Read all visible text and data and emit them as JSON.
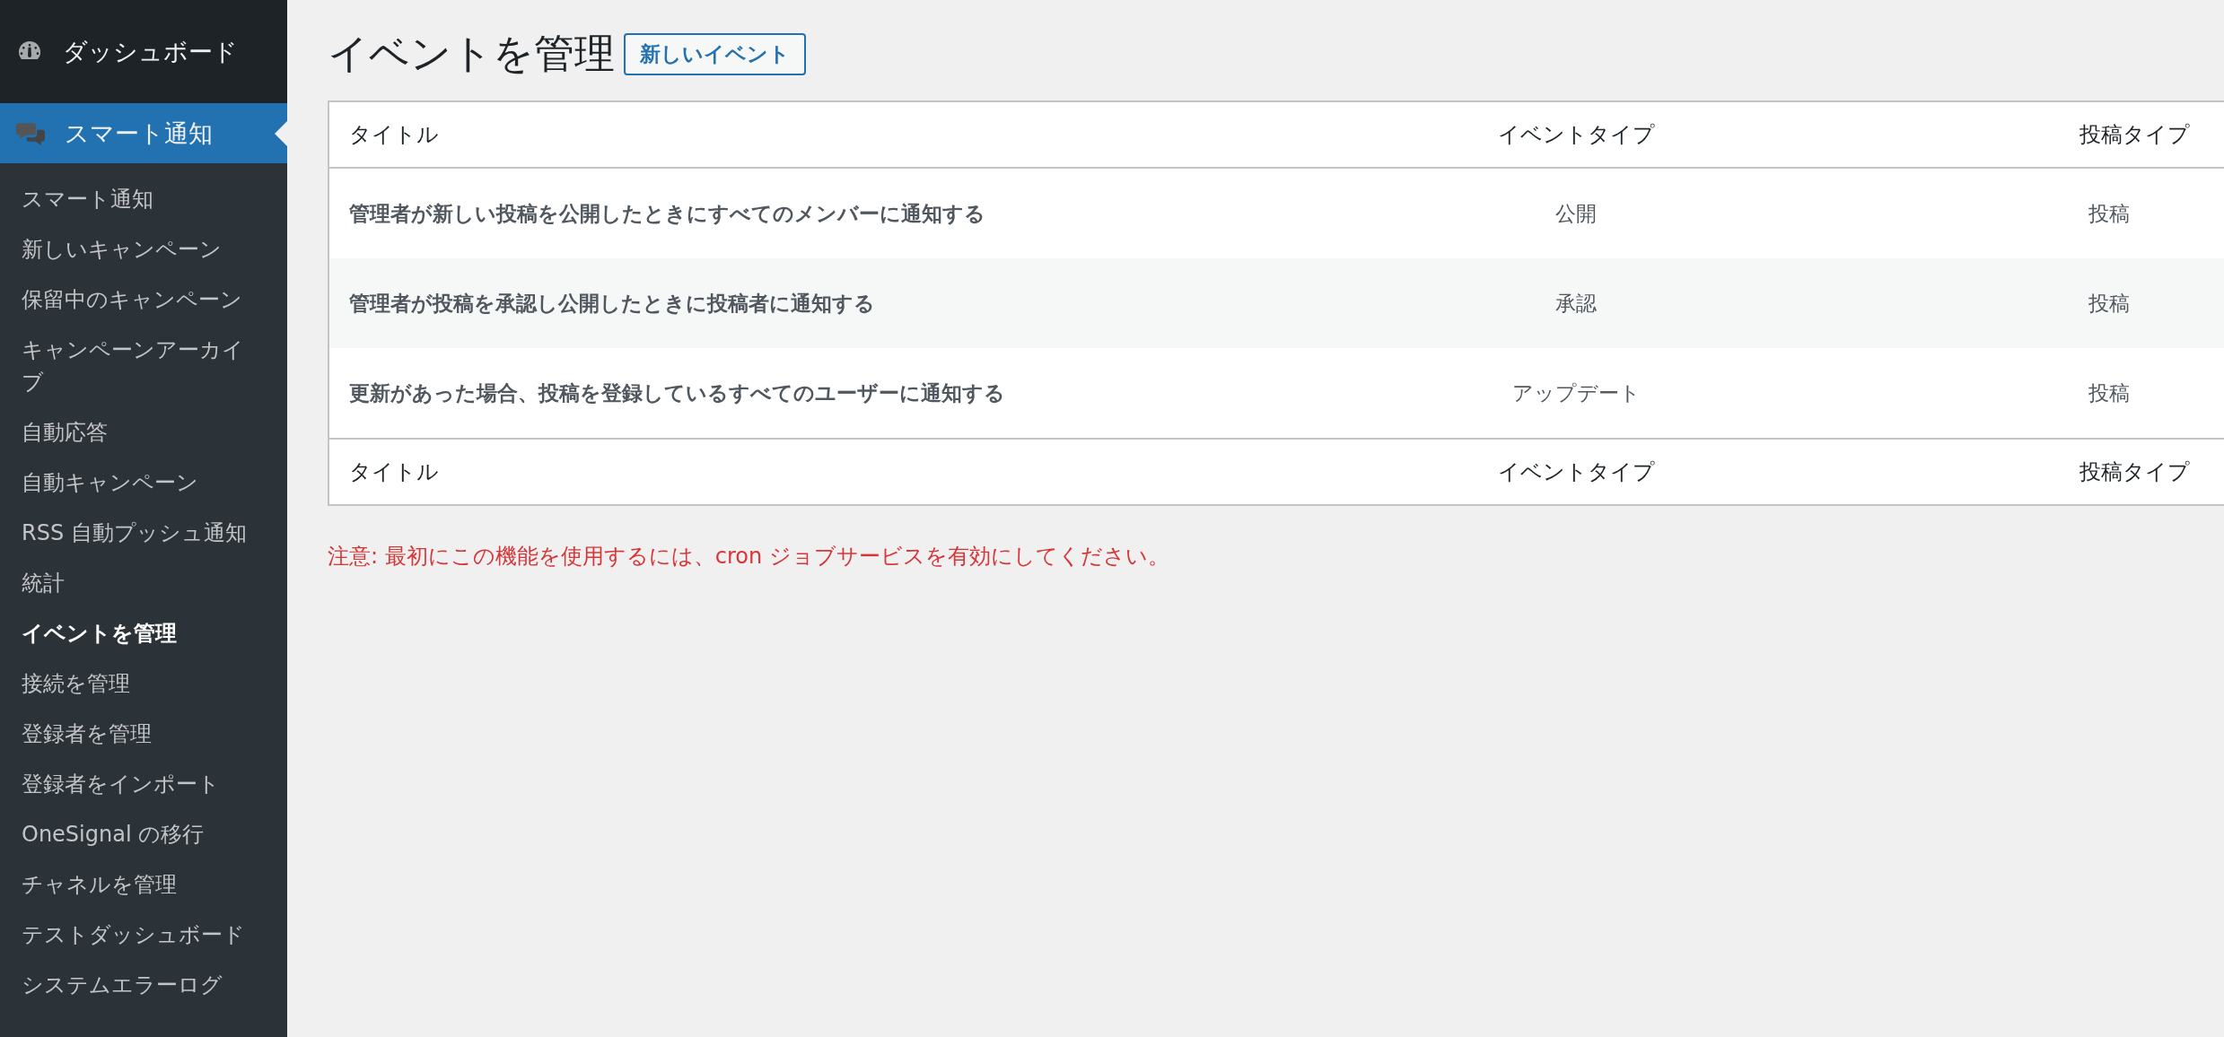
{
  "sidebar": {
    "top_items": [
      {
        "label": "ダッシュボード",
        "selected": false
      },
      {
        "label": "スマート通知",
        "selected": true
      }
    ],
    "submenu": [
      {
        "label": "スマート通知",
        "selected": false
      },
      {
        "label": "新しいキャンペーン",
        "selected": false
      },
      {
        "label": "保留中のキャンペーン",
        "selected": false
      },
      {
        "label": "キャンペーンアーカイブ",
        "selected": false
      },
      {
        "label": "自動応答",
        "selected": false
      },
      {
        "label": "自動キャンペーン",
        "selected": false
      },
      {
        "label": "RSS 自動プッシュ通知",
        "selected": false
      },
      {
        "label": "統計",
        "selected": false
      },
      {
        "label": "イベントを管理",
        "selected": true
      },
      {
        "label": "接続を管理",
        "selected": false
      },
      {
        "label": "登録者を管理",
        "selected": false
      },
      {
        "label": "登録者をインポート",
        "selected": false
      },
      {
        "label": "OneSignal の移行",
        "selected": false
      },
      {
        "label": "チャネルを管理",
        "selected": false
      },
      {
        "label": "テストダッシュボード",
        "selected": false
      },
      {
        "label": "システムエラーログ",
        "selected": false
      }
    ]
  },
  "page": {
    "title": "イベントを管理",
    "add_button": "新しいイベント"
  },
  "table": {
    "columns": [
      "タイトル",
      "イベントタイプ",
      "投稿タイプ"
    ],
    "rows": [
      {
        "title": "管理者が新しい投稿を公開したときにすべてのメンバーに通知する",
        "event_type": "公開",
        "post_type": "投稿"
      },
      {
        "title": "管理者が投稿を承認し公開したときに投稿者に通知する",
        "event_type": "承認",
        "post_type": "投稿"
      },
      {
        "title": "更新があった場合、投稿を登録しているすべてのユーザーに通知する",
        "event_type": "アップデート",
        "post_type": "投稿"
      }
    ],
    "footer_columns": [
      "タイトル",
      "イベントタイプ",
      "投稿タイプ"
    ]
  },
  "notice": "注意: 最初にこの機能を使用するには、cron ジョブサービスを有効にしてください。"
}
